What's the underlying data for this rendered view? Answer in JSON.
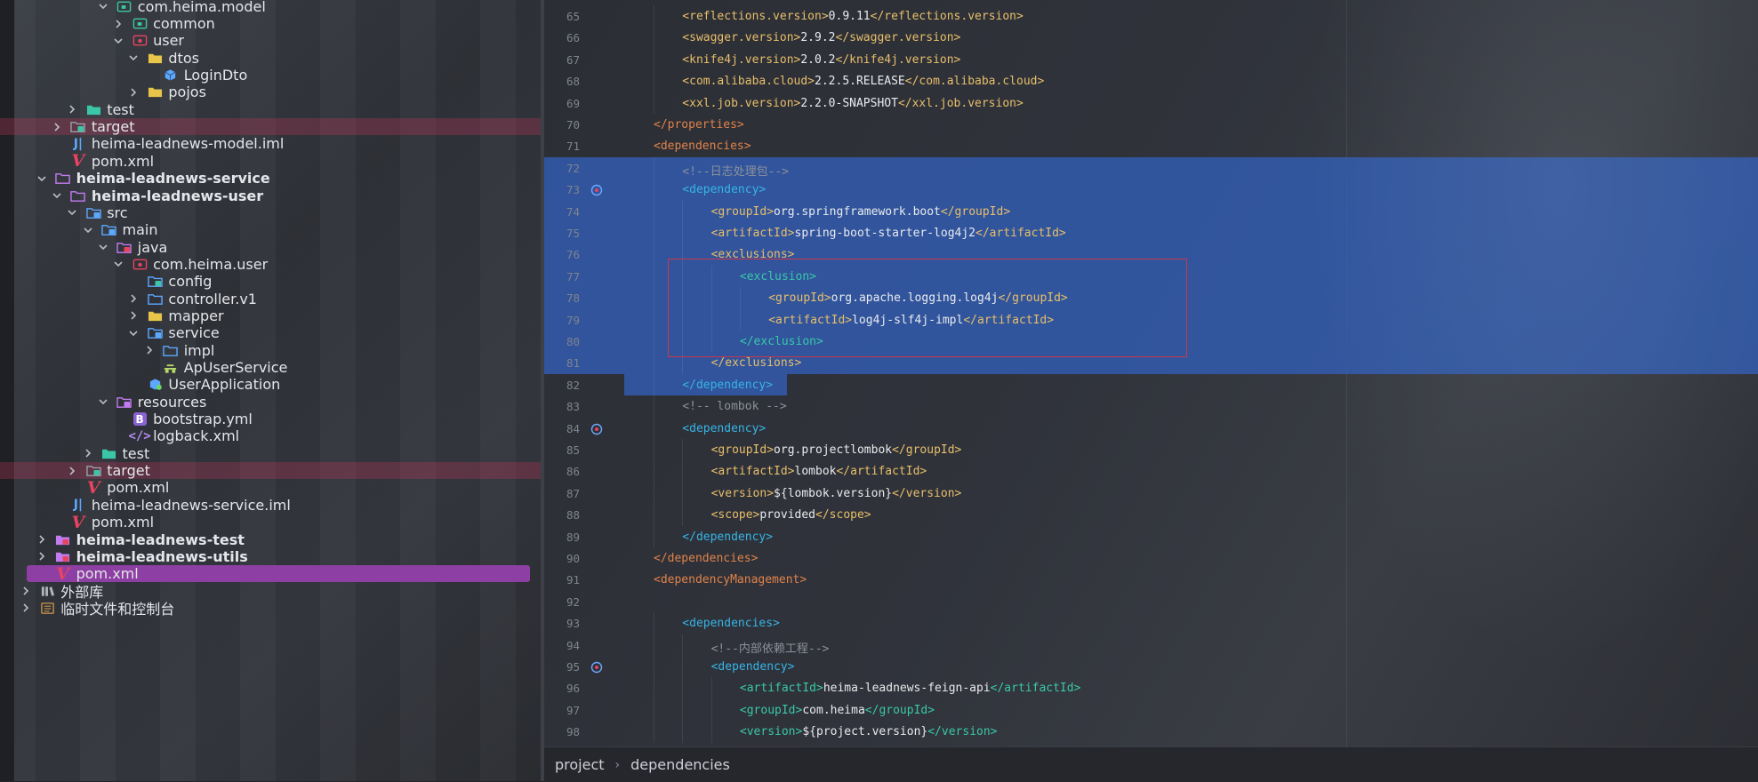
{
  "project_tree": [
    {
      "depth": 6,
      "chevron": "down",
      "icon": "package",
      "label": "com.heima.model",
      "bold": false,
      "band": false,
      "selected": false
    },
    {
      "depth": 7,
      "chevron": "right",
      "icon": "package",
      "label": "common",
      "bold": false,
      "band": false,
      "selected": false
    },
    {
      "depth": 7,
      "chevron": "down",
      "icon": "package-red",
      "label": "user",
      "bold": false,
      "band": false,
      "selected": false
    },
    {
      "depth": 8,
      "chevron": "down",
      "icon": "folder-yellow",
      "label": "dtos",
      "bold": false,
      "band": false,
      "selected": false
    },
    {
      "depth": 9,
      "chevron": "none",
      "icon": "class-cube",
      "label": "LoginDto",
      "bold": false,
      "band": false,
      "selected": false
    },
    {
      "depth": 8,
      "chevron": "right",
      "icon": "folder-yellow",
      "label": "pojos",
      "bold": false,
      "band": false,
      "selected": false
    },
    {
      "depth": 4,
      "chevron": "right",
      "icon": "folder-green",
      "label": "test",
      "bold": false,
      "band": false,
      "selected": false
    },
    {
      "depth": 3,
      "chevron": "right",
      "icon": "folder-target",
      "label": "target",
      "bold": false,
      "band": true,
      "selected": false
    },
    {
      "depth": 3,
      "chevron": "none",
      "icon": "iml",
      "label": "heima-leadnews-model.iml",
      "bold": false,
      "band": false,
      "selected": false
    },
    {
      "depth": 3,
      "chevron": "none",
      "icon": "maven",
      "label": "pom.xml",
      "bold": false,
      "band": false,
      "selected": false
    },
    {
      "depth": 2,
      "chevron": "down",
      "icon": "folder-module",
      "label": "heima-leadnews-service",
      "bold": true,
      "band": false,
      "selected": false
    },
    {
      "depth": 3,
      "chevron": "down",
      "icon": "folder-module",
      "label": "heima-leadnews-user",
      "bold": true,
      "band": false,
      "selected": false
    },
    {
      "depth": 4,
      "chevron": "down",
      "icon": "folder-src",
      "label": "src",
      "bold": false,
      "band": false,
      "selected": false
    },
    {
      "depth": 5,
      "chevron": "down",
      "icon": "folder-src",
      "label": "main",
      "bold": false,
      "band": false,
      "selected": false
    },
    {
      "depth": 6,
      "chevron": "down",
      "icon": "folder-java",
      "label": "java",
      "bold": false,
      "band": false,
      "selected": false
    },
    {
      "depth": 7,
      "chevron": "down",
      "icon": "package-red",
      "label": "com.heima.user",
      "bold": false,
      "band": false,
      "selected": false
    },
    {
      "depth": 8,
      "chevron": "none",
      "icon": "folder-config",
      "label": "config",
      "bold": false,
      "band": false,
      "selected": false
    },
    {
      "depth": 8,
      "chevron": "right",
      "icon": "folder-plain",
      "label": "controller.v1",
      "bold": false,
      "band": false,
      "selected": false
    },
    {
      "depth": 8,
      "chevron": "right",
      "icon": "folder-yellow",
      "label": "mapper",
      "bold": false,
      "band": false,
      "selected": false
    },
    {
      "depth": 8,
      "chevron": "down",
      "icon": "folder-service",
      "label": "service",
      "bold": false,
      "band": false,
      "selected": false
    },
    {
      "depth": 9,
      "chevron": "right",
      "icon": "folder-plain",
      "label": "impl",
      "bold": false,
      "band": false,
      "selected": false
    },
    {
      "depth": 9,
      "chevron": "none",
      "icon": "interface",
      "label": "ApUserService",
      "bold": false,
      "band": false,
      "selected": false
    },
    {
      "depth": 8,
      "chevron": "none",
      "icon": "spring-app",
      "label": "UserApplication",
      "bold": false,
      "band": false,
      "selected": false
    },
    {
      "depth": 6,
      "chevron": "down",
      "icon": "folder-resources",
      "label": "resources",
      "bold": false,
      "band": false,
      "selected": false
    },
    {
      "depth": 7,
      "chevron": "none",
      "icon": "yml",
      "label": "bootstrap.yml",
      "bold": false,
      "band": false,
      "selected": false
    },
    {
      "depth": 7,
      "chevron": "none",
      "icon": "xml",
      "label": "logback.xml",
      "bold": false,
      "band": false,
      "selected": false
    },
    {
      "depth": 5,
      "chevron": "right",
      "icon": "folder-green",
      "label": "test",
      "bold": false,
      "band": false,
      "selected": false
    },
    {
      "depth": 4,
      "chevron": "right",
      "icon": "folder-target",
      "label": "target",
      "bold": false,
      "band": true,
      "selected": false
    },
    {
      "depth": 4,
      "chevron": "none",
      "icon": "maven",
      "label": "pom.xml",
      "bold": false,
      "band": false,
      "selected": false
    },
    {
      "depth": 3,
      "chevron": "none",
      "icon": "iml",
      "label": "heima-leadnews-service.iml",
      "bold": false,
      "band": false,
      "selected": false
    },
    {
      "depth": 3,
      "chevron": "none",
      "icon": "maven",
      "label": "pom.xml",
      "bold": false,
      "band": false,
      "selected": false
    },
    {
      "depth": 2,
      "chevron": "right",
      "icon": "folder-module-pink",
      "label": "heima-leadnews-test",
      "bold": true,
      "band": false,
      "selected": false
    },
    {
      "depth": 2,
      "chevron": "right",
      "icon": "folder-module-pink",
      "label": "heima-leadnews-utils",
      "bold": true,
      "band": false,
      "selected": false
    },
    {
      "depth": 2,
      "chevron": "none",
      "icon": "maven",
      "label": "pom.xml",
      "bold": false,
      "band": false,
      "selected": true
    },
    {
      "depth": 1,
      "chevron": "right",
      "icon": "library",
      "label": "外部库",
      "bold": false,
      "band": false,
      "selected": false
    },
    {
      "depth": 1,
      "chevron": "right",
      "icon": "scratches",
      "label": "临时文件和控制台",
      "bold": false,
      "band": false,
      "selected": false
    }
  ],
  "code_lines": [
    {
      "n": "65",
      "indent": 2,
      "sel": false,
      "mark": false,
      "tokens": [
        [
          "t-tag",
          "<reflections.version>"
        ],
        [
          "t-txt",
          "0.9.11"
        ],
        [
          "t-tag",
          "</reflections.version>"
        ]
      ]
    },
    {
      "n": "66",
      "indent": 2,
      "sel": false,
      "mark": false,
      "tokens": [
        [
          "t-tag",
          "<swagger.version>"
        ],
        [
          "t-txt",
          "2.9.2"
        ],
        [
          "t-tag",
          "</swagger.version>"
        ]
      ]
    },
    {
      "n": "67",
      "indent": 2,
      "sel": false,
      "mark": false,
      "tokens": [
        [
          "t-tag",
          "<knife4j.version>"
        ],
        [
          "t-txt",
          "2.0.2"
        ],
        [
          "t-tag",
          "</knife4j.version>"
        ]
      ]
    },
    {
      "n": "68",
      "indent": 2,
      "sel": false,
      "mark": false,
      "tokens": [
        [
          "t-tag",
          "<com.alibaba.cloud>"
        ],
        [
          "t-txt",
          "2.2.5.RELEASE"
        ],
        [
          "t-tag",
          "</com.alibaba.cloud>"
        ]
      ]
    },
    {
      "n": "69",
      "indent": 2,
      "sel": false,
      "mark": false,
      "tokens": [
        [
          "t-tag",
          "<xxl.job.version>"
        ],
        [
          "t-txt",
          "2.2.0-SNAPSHOT"
        ],
        [
          "t-tag",
          "</xxl.job.version>"
        ]
      ]
    },
    {
      "n": "70",
      "indent": 1,
      "sel": false,
      "mark": false,
      "tokens": [
        [
          "t-tag4",
          "</properties>"
        ]
      ]
    },
    {
      "n": "71",
      "indent": 1,
      "sel": false,
      "mark": false,
      "tokens": [
        [
          "t-tag4",
          "<dependencies>"
        ]
      ]
    },
    {
      "n": "72",
      "indent": 2,
      "sel": true,
      "mark": false,
      "tokens": [
        [
          "t-cmt",
          "<!--日志处理包-->"
        ]
      ]
    },
    {
      "n": "73",
      "indent": 2,
      "sel": true,
      "mark": true,
      "tokens": [
        [
          "t-tag2",
          "<dependency>"
        ]
      ]
    },
    {
      "n": "74",
      "indent": 3,
      "sel": true,
      "mark": false,
      "tokens": [
        [
          "t-tag",
          "<groupId>"
        ],
        [
          "t-txt",
          "org.springframework.boot"
        ],
        [
          "t-tag",
          "</groupId>"
        ]
      ]
    },
    {
      "n": "75",
      "indent": 3,
      "sel": true,
      "mark": false,
      "tokens": [
        [
          "t-tag",
          "<artifactId>"
        ],
        [
          "t-txt",
          "spring-boot-starter-log4j2"
        ],
        [
          "t-tag",
          "</artifactId>"
        ]
      ]
    },
    {
      "n": "76",
      "indent": 3,
      "sel": true,
      "mark": false,
      "tokens": [
        [
          "t-tag",
          "<exclusions>"
        ]
      ]
    },
    {
      "n": "77",
      "indent": 4,
      "sel": true,
      "mark": false,
      "tokens": [
        [
          "t-tag3",
          "<exclusion>"
        ]
      ]
    },
    {
      "n": "78",
      "indent": 5,
      "sel": true,
      "mark": false,
      "tokens": [
        [
          "t-tag",
          "<groupId>"
        ],
        [
          "t-txt",
          "org.apache.logging.log4j"
        ],
        [
          "t-tag",
          "</groupId>"
        ]
      ]
    },
    {
      "n": "79",
      "indent": 5,
      "sel": true,
      "mark": false,
      "tokens": [
        [
          "t-tag",
          "<artifactId>"
        ],
        [
          "t-txt",
          "log4j-slf4j-impl"
        ],
        [
          "t-tag",
          "</artifactId>"
        ]
      ]
    },
    {
      "n": "80",
      "indent": 4,
      "sel": true,
      "mark": false,
      "tokens": [
        [
          "t-tag3",
          "</exclusion>"
        ]
      ]
    },
    {
      "n": "81",
      "indent": 3,
      "sel": true,
      "mark": false,
      "tokens": [
        [
          "t-tag",
          "</exclusions>"
        ]
      ]
    },
    {
      "n": "82",
      "indent": 2,
      "sel": "partial",
      "mark": false,
      "tokens": [
        [
          "t-tag2",
          "</dependency>"
        ]
      ]
    },
    {
      "n": "83",
      "indent": 2,
      "sel": false,
      "mark": false,
      "tokens": [
        [
          "t-cmt",
          "<!-- lombok -->"
        ]
      ]
    },
    {
      "n": "84",
      "indent": 2,
      "sel": false,
      "mark": true,
      "tokens": [
        [
          "t-tag2",
          "<dependency>"
        ]
      ]
    },
    {
      "n": "85",
      "indent": 3,
      "sel": false,
      "mark": false,
      "tokens": [
        [
          "t-tag",
          "<groupId>"
        ],
        [
          "t-txt",
          "org.projectlombok"
        ],
        [
          "t-tag",
          "</groupId>"
        ]
      ]
    },
    {
      "n": "86",
      "indent": 3,
      "sel": false,
      "mark": false,
      "tokens": [
        [
          "t-tag",
          "<artifactId>"
        ],
        [
          "t-txt",
          "lombok"
        ],
        [
          "t-tag",
          "</artifactId>"
        ]
      ]
    },
    {
      "n": "87",
      "indent": 3,
      "sel": false,
      "mark": false,
      "tokens": [
        [
          "t-tag",
          "<version>"
        ],
        [
          "t-txt",
          "${lombok.version}"
        ],
        [
          "t-tag",
          "</version>"
        ]
      ]
    },
    {
      "n": "88",
      "indent": 3,
      "sel": false,
      "mark": false,
      "tokens": [
        [
          "t-tag",
          "<scope>"
        ],
        [
          "t-txt",
          "provided"
        ],
        [
          "t-tag",
          "</scope>"
        ]
      ]
    },
    {
      "n": "89",
      "indent": 2,
      "sel": false,
      "mark": false,
      "tokens": [
        [
          "t-tag2",
          "</dependency>"
        ]
      ]
    },
    {
      "n": "90",
      "indent": 1,
      "sel": false,
      "mark": false,
      "tokens": [
        [
          "t-tag4",
          "</dependencies>"
        ]
      ]
    },
    {
      "n": "91",
      "indent": 1,
      "sel": false,
      "mark": false,
      "tokens": [
        [
          "t-tag4",
          "<dependencyManagement>"
        ]
      ]
    },
    {
      "n": "92",
      "indent": 1,
      "sel": false,
      "mark": false,
      "tokens": []
    },
    {
      "n": "93",
      "indent": 2,
      "sel": false,
      "mark": false,
      "tokens": [
        [
          "t-tag2",
          "<dependencies>"
        ]
      ]
    },
    {
      "n": "94",
      "indent": 3,
      "sel": false,
      "mark": false,
      "tokens": [
        [
          "t-cmt",
          "<!--内部依赖工程-->"
        ]
      ]
    },
    {
      "n": "95",
      "indent": 3,
      "sel": false,
      "mark": true,
      "tokens": [
        [
          "t-tag2",
          "<dependency>"
        ]
      ]
    },
    {
      "n": "96",
      "indent": 4,
      "sel": false,
      "mark": false,
      "tokens": [
        [
          "t-tag3",
          "<artifactId>"
        ],
        [
          "t-txt",
          "heima-leadnews-feign-api"
        ],
        [
          "t-tag3",
          "</artifactId>"
        ]
      ]
    },
    {
      "n": "97",
      "indent": 4,
      "sel": false,
      "mark": false,
      "tokens": [
        [
          "t-tag3",
          "<groupId>"
        ],
        [
          "t-txt",
          "com.heima"
        ],
        [
          "t-tag3",
          "</groupId>"
        ]
      ]
    },
    {
      "n": "98",
      "indent": 4,
      "sel": false,
      "mark": false,
      "tokens": [
        [
          "t-tag3",
          "<version>"
        ],
        [
          "t-txt",
          "${project.version}"
        ],
        [
          "t-tag3",
          "</version>"
        ]
      ]
    }
  ],
  "breadcrumb": {
    "items": [
      "project",
      "dependencies"
    ],
    "separator": "›"
  },
  "colors": {
    "selection": "#325fb9",
    "tree_selected": "#8d3fa3",
    "band": "#cd375f",
    "red_box": "#c9384a"
  }
}
